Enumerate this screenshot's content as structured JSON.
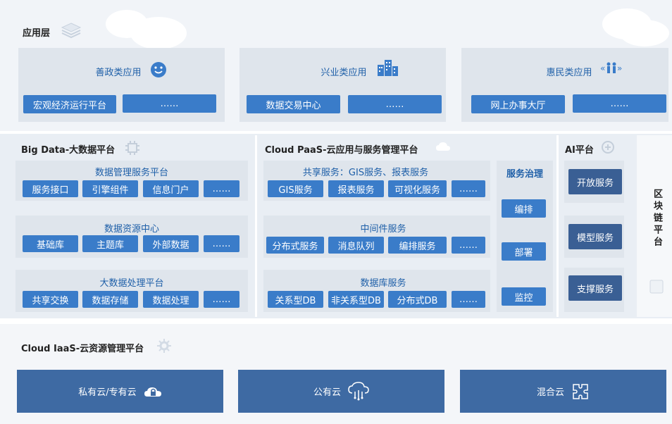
{
  "app_layer": {
    "title": "应用层",
    "groups": [
      {
        "title": "善政类应用",
        "items": [
          "宏观经济运行平台",
          "……"
        ]
      },
      {
        "title": "兴业类应用",
        "items": [
          "数据交易中心",
          "……"
        ]
      },
      {
        "title": "惠民类应用",
        "items": [
          "网上办事大厅",
          "……"
        ]
      }
    ]
  },
  "bigdata": {
    "title": "Big Data-大数据平台",
    "sections": [
      {
        "title": "数据管理服务平台",
        "items": [
          "服务接口",
          "引擎组件",
          "信息门户",
          "……"
        ]
      },
      {
        "title": "数据资源中心",
        "items": [
          "基础库",
          "主题库",
          "外部数据",
          "……"
        ]
      },
      {
        "title": "大数据处理平台",
        "items": [
          "共享交换",
          "数据存储",
          "数据处理",
          "……"
        ]
      }
    ]
  },
  "paas": {
    "title": "Cloud PaaS-云应用与服务管理平台",
    "sections": [
      {
        "title": "共享服务：GIS服务、报表服务",
        "items": [
          "GIS服务",
          "报表服务",
          "可视化服务",
          "……"
        ]
      },
      {
        "title": "中间件服务",
        "items": [
          "分布式服务",
          "消息队列",
          "编排服务",
          "……"
        ]
      },
      {
        "title": "数据库服务",
        "items": [
          "关系型DB",
          "非关系型DB",
          "分布式DB",
          "……"
        ]
      }
    ],
    "governance": {
      "title": "服务治理",
      "items": [
        "编排",
        "部署",
        "监控"
      ]
    }
  },
  "ai": {
    "title": "AI平台",
    "items": [
      "开放服务",
      "模型服务",
      "支撑服务"
    ]
  },
  "blockchain": {
    "title": "区块链平台"
  },
  "iaas": {
    "title": "Cloud IaaS-云资源管理平台",
    "items": [
      "私有云/专有云",
      "公有云",
      "混合云"
    ]
  },
  "colors": {
    "band": "#eef2f7",
    "panel": "#dfe5ec",
    "button": "#3a7cc9",
    "button_dark": "#3a5f94",
    "iaas": "#3e6aa3",
    "subtitle": "#1e5fa8"
  },
  "icons": [
    "layers-icon",
    "smiley-icon",
    "buildings-icon",
    "people-icon",
    "chip-icon",
    "cloud-icon",
    "brain-icon",
    "block-icon",
    "gear-icon",
    "lock-icon",
    "cloud-network-icon",
    "puzzle-icon"
  ]
}
